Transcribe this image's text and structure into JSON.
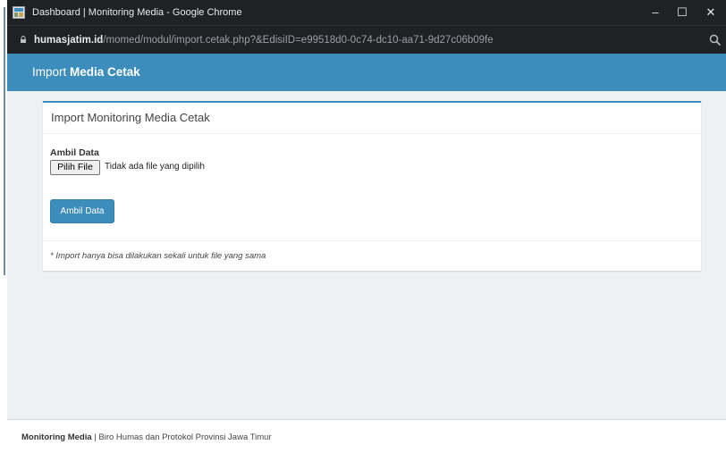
{
  "browser": {
    "window_title": "Dashboard | Monitoring Media - Google Chrome",
    "url_host": "humasjatim.id",
    "url_path": "/momed/modul/import.cetak.php?&EdisiID=e99518d0-0c74-dc10-aa71-9d27c06b09fe",
    "minimize": "–",
    "maximize": "☐",
    "close": "✕"
  },
  "header": {
    "prefix": "Import ",
    "bold": "Media Cetak"
  },
  "panel": {
    "title": "Import Monitoring Media Cetak",
    "field_label": "Ambil Data",
    "file_button": "Pilih File",
    "file_status": "Tidak ada file yang dipilih",
    "submit_label": "Ambil Data",
    "note": "* Import hanya bisa dilakukan sekali untuk file yang sama"
  },
  "footer": {
    "brand": "Monitoring Media",
    "text": " | Biro Humas dan Protokol Provinsi Jawa Timur"
  },
  "colors": {
    "accent": "#3c8dbc",
    "chrome_dark": "#202124",
    "page_bg": "#eef0f2"
  }
}
